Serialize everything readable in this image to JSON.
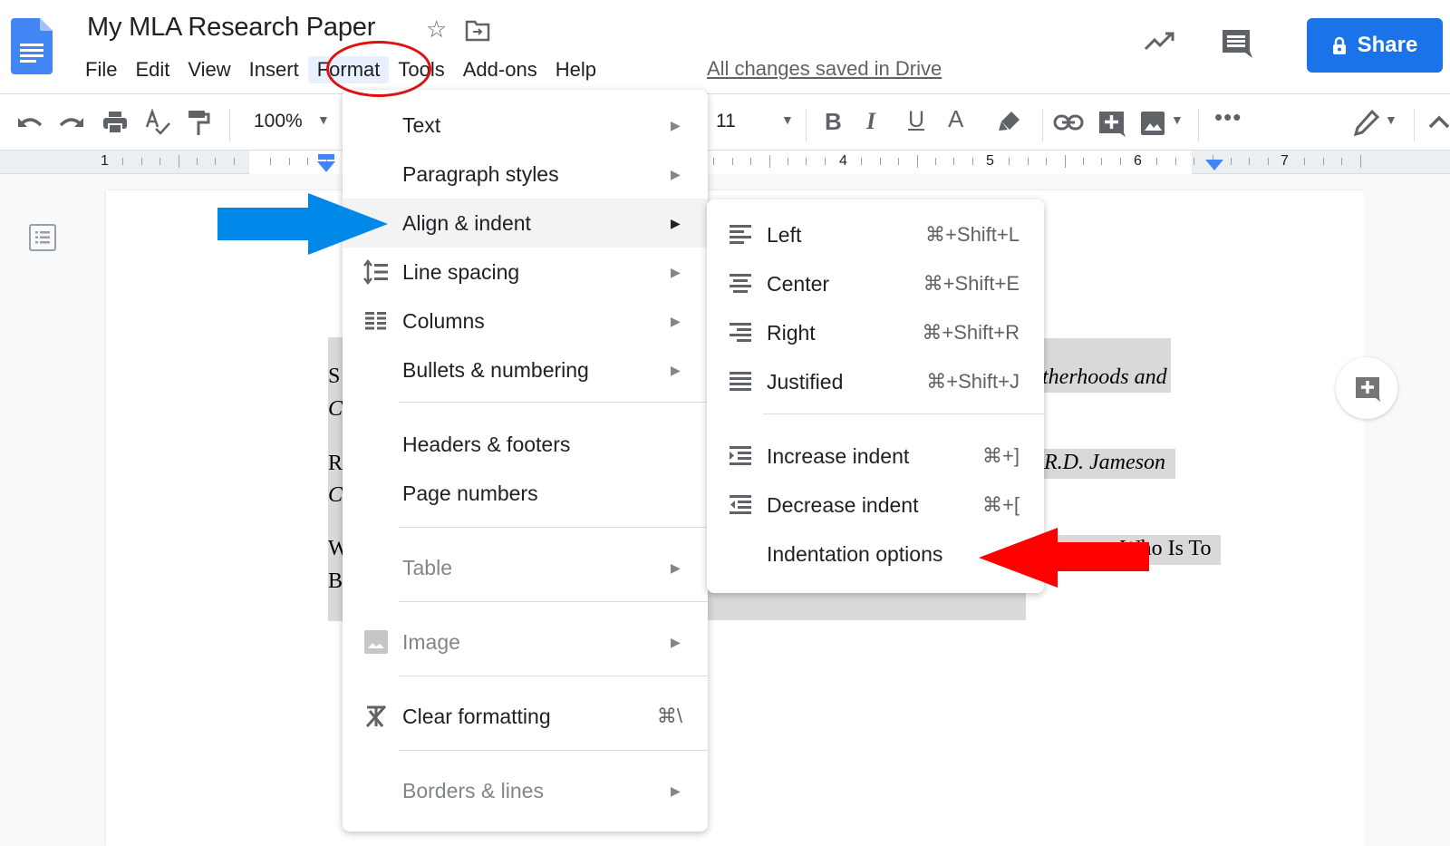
{
  "header": {
    "title": "My MLA Research Paper",
    "menu": [
      "File",
      "Edit",
      "View",
      "Insert",
      "Format",
      "Tools",
      "Add-ons",
      "Help"
    ],
    "active_menu": "Format",
    "saved_status": "All changes saved in Drive",
    "share_label": "Share"
  },
  "toolbar": {
    "zoom": "100%",
    "font_size": "11"
  },
  "ruler": {
    "numbers": [
      "1",
      "4",
      "5",
      "6",
      "7"
    ]
  },
  "document": {
    "fragments": [
      "S",
      "C",
      "R",
      "C",
      "W",
      "B",
      "therhoods and",
      "R.D. Jameson",
      "Who Is To"
    ]
  },
  "format_menu": {
    "items": [
      {
        "label": "Text",
        "submenu": true
      },
      {
        "label": "Paragraph styles",
        "submenu": true
      },
      {
        "label": "Align & indent",
        "submenu": true,
        "highlighted": true
      },
      {
        "label": "Line spacing",
        "submenu": true,
        "icon": "line-spacing-icon"
      },
      {
        "label": "Columns",
        "submenu": true,
        "icon": "columns-icon"
      },
      {
        "label": "Bullets & numbering",
        "submenu": true
      },
      {
        "label": "Headers & footers"
      },
      {
        "label": "Page numbers"
      },
      {
        "label": "Table",
        "submenu": true,
        "disabled": true
      },
      {
        "label": "Image",
        "submenu": true,
        "disabled": true,
        "icon": "image-icon"
      },
      {
        "label": "Clear formatting",
        "shortcut": "⌘\\",
        "icon": "clear-formatting-icon"
      },
      {
        "label": "Borders & lines",
        "submenu": true,
        "disabled": true
      }
    ]
  },
  "align_submenu": {
    "items": [
      {
        "label": "Left",
        "shortcut": "⌘+Shift+L",
        "icon": "align-left-icon"
      },
      {
        "label": "Center",
        "shortcut": "⌘+Shift+E",
        "icon": "align-center-icon"
      },
      {
        "label": "Right",
        "shortcut": "⌘+Shift+R",
        "icon": "align-right-icon"
      },
      {
        "label": "Justified",
        "shortcut": "⌘+Shift+J",
        "icon": "align-justify-icon"
      },
      {
        "label": "Increase indent",
        "shortcut": "⌘+]",
        "icon": "increase-indent-icon"
      },
      {
        "label": "Decrease indent",
        "shortcut": "⌘+[",
        "icon": "decrease-indent-icon"
      },
      {
        "label": "Indentation options"
      }
    ]
  },
  "annotations": {
    "blue_arrow_color": "#0088e8",
    "red_arrow_color": "#ff0000",
    "circle_color": "#e01010"
  },
  "colors": {
    "share_button": "#1a73e8",
    "menu_hover": "#f1f3f4",
    "highlight": "#d9d9d9"
  }
}
